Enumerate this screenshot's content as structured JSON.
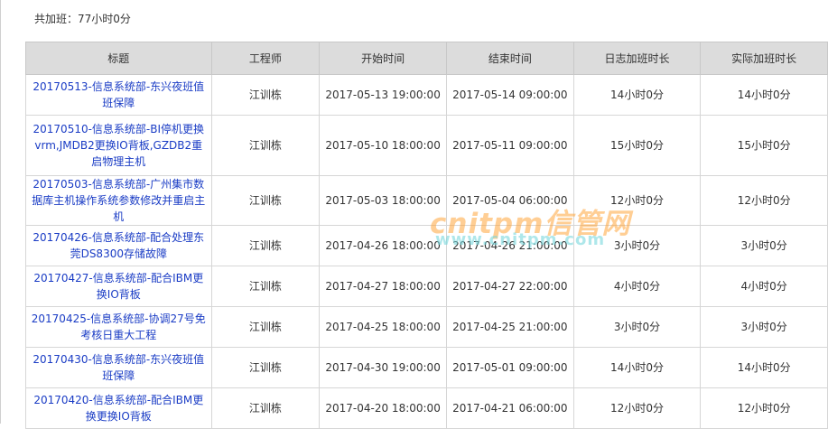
{
  "summary": "共加班：77小时0分",
  "columns": [
    "标题",
    "工程师",
    "开始时间",
    "结束时间",
    "日志加班时长",
    "实际加班时长"
  ],
  "rows": [
    {
      "title": "20170513-信息系统部-东兴夜班值班保障",
      "engineer": "江训栋",
      "start": "2017-05-13 19:00:00",
      "end": "2017-05-14 09:00:00",
      "log_hours": "14小时0分",
      "actual_hours": "14小时0分"
    },
    {
      "title": "20170510-信息系统部-BI停机更换vrm,JMDB2更换IO背板,GZDB2重启物理主机",
      "engineer": "江训栋",
      "start": "2017-05-10 18:00:00",
      "end": "2017-05-11 09:00:00",
      "log_hours": "15小时0分",
      "actual_hours": "15小时0分"
    },
    {
      "title": "20170503-信息系统部-广州集市数据库主机操作系统参数修改并重启主机",
      "engineer": "江训栋",
      "start": "2017-05-03 18:00:00",
      "end": "2017-05-04 06:00:00",
      "log_hours": "12小时0分",
      "actual_hours": "12小时0分"
    },
    {
      "title": "20170426-信息系统部-配合处理东莞DS8300存储故障",
      "engineer": "江训栋",
      "start": "2017-04-26 18:00:00",
      "end": "2017-04-26 21:00:00",
      "log_hours": "3小时0分",
      "actual_hours": "3小时0分"
    },
    {
      "title": "20170427-信息系统部-配合IBM更换IO背板",
      "engineer": "江训栋",
      "start": "2017-04-27 18:00:00",
      "end": "2017-04-27 22:00:00",
      "log_hours": "4小时0分",
      "actual_hours": "4小时0分"
    },
    {
      "title": "20170425-信息系统部-协调27号免考核日重大工程",
      "engineer": "江训栋",
      "start": "2017-04-25 18:00:00",
      "end": "2017-04-25 21:00:00",
      "log_hours": "3小时0分",
      "actual_hours": "3小时0分"
    },
    {
      "title": "20170430-信息系统部-东兴夜班值班保障",
      "engineer": "江训栋",
      "start": "2017-04-30 19:00:00",
      "end": "2017-05-01 09:00:00",
      "log_hours": "14小时0分",
      "actual_hours": "14小时0分"
    },
    {
      "title": "20170420-信息系统部-配合IBM更换更换IO背板",
      "engineer": "江训栋",
      "start": "2017-04-20 18:00:00",
      "end": "2017-04-21 06:00:00",
      "log_hours": "12小时0分",
      "actual_hours": "12小时0分"
    }
  ],
  "watermark": {
    "brand": "cnitpm信管网",
    "url": "www.cnitpm.com"
  }
}
